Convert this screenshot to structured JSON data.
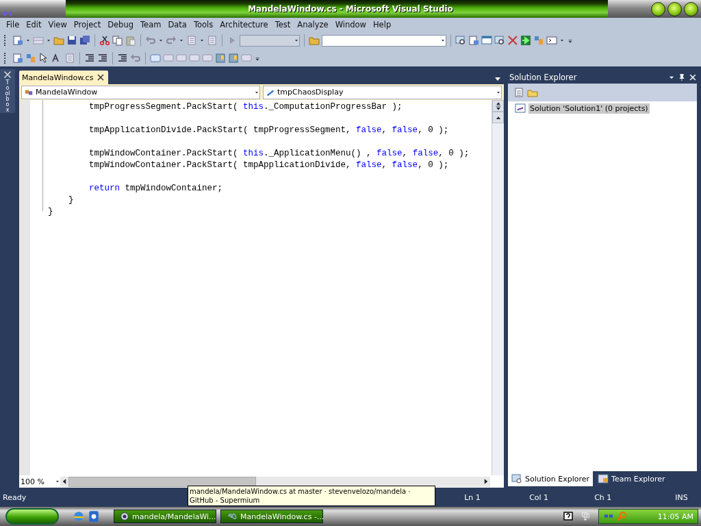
{
  "window": {
    "title": "MandelaWindow.cs - Microsoft Visual Studio"
  },
  "menu": [
    "File",
    "Edit",
    "View",
    "Project",
    "Debug",
    "Team",
    "Data",
    "Tools",
    "Architecture",
    "Test",
    "Analyze",
    "Window",
    "Help"
  ],
  "toolbox": {
    "label": "Toolbox"
  },
  "editor": {
    "tabs": [
      {
        "label": "MandelaWindow.cs",
        "selected": true
      }
    ],
    "type_dropdown": "MandelaWindow",
    "member_dropdown": "tmpChaosDisplay",
    "lines": [
      {
        "kind": "code",
        "tokens": [
          {
            "kind": "plain",
            "text": "        tmpProgressSegment.PackStart( "
          },
          {
            "kind": "keyword",
            "text": "this"
          },
          {
            "kind": "plain",
            "text": "._ComputationProgressBar );"
          }
        ]
      },
      {
        "kind": "blank"
      },
      {
        "kind": "code",
        "tokens": [
          {
            "kind": "plain",
            "text": "        tmpApplicationDivide.PackStart( tmpProgressSegment, "
          },
          {
            "kind": "keyword",
            "text": "false"
          },
          {
            "kind": "plain",
            "text": ", "
          },
          {
            "kind": "keyword",
            "text": "false"
          },
          {
            "kind": "plain",
            "text": ", 0 );"
          }
        ]
      },
      {
        "kind": "blank"
      },
      {
        "kind": "code",
        "tokens": [
          {
            "kind": "plain",
            "text": "        tmpWindowContainer.PackStart( "
          },
          {
            "kind": "keyword",
            "text": "this"
          },
          {
            "kind": "plain",
            "text": "._ApplicationMenu() , "
          },
          {
            "kind": "keyword",
            "text": "false"
          },
          {
            "kind": "plain",
            "text": ", "
          },
          {
            "kind": "keyword",
            "text": "false"
          },
          {
            "kind": "plain",
            "text": ", 0 );"
          }
        ]
      },
      {
        "kind": "code",
        "tokens": [
          {
            "kind": "plain",
            "text": "        tmpWindowContainer.PackStart( tmpApplicationDivide, "
          },
          {
            "kind": "keyword",
            "text": "false"
          },
          {
            "kind": "plain",
            "text": ", "
          },
          {
            "kind": "keyword",
            "text": "false"
          },
          {
            "kind": "plain",
            "text": ", 0 );"
          }
        ]
      },
      {
        "kind": "blank"
      },
      {
        "kind": "code",
        "tokens": [
          {
            "kind": "keyword",
            "text": "        return"
          },
          {
            "kind": "plain",
            "text": " tmpWindowContainer;"
          }
        ]
      },
      {
        "kind": "code",
        "tokens": [
          {
            "kind": "plain",
            "text": "    }"
          }
        ]
      },
      {
        "kind": "code",
        "tokens": [
          {
            "kind": "plain",
            "text": "}"
          }
        ]
      }
    ],
    "zoom": "100 %"
  },
  "solution_explorer": {
    "title": "Solution Explorer",
    "tree": [
      {
        "label": "Solution 'Solution1' (0 projects)",
        "selected": true
      }
    ],
    "tabs": [
      {
        "label": "Solution Explorer",
        "selected": true
      },
      {
        "label": "Team Explorer",
        "selected": false
      }
    ]
  },
  "status_bar": {
    "message": "Ready",
    "line": "Ln 1",
    "column": "Col 1",
    "char": "Ch 1",
    "mode": "INS"
  },
  "tooltip": {
    "text": "mandela/MandelaWindow.cs at master · stevenvelozo/mandela · GitHub - Supermium"
  },
  "taskbar": {
    "tasks": [
      {
        "label": "mandela/MandelaWi...",
        "kind": "browser"
      },
      {
        "label": "MandelaWindow.cs -...",
        "kind": "studio"
      }
    ],
    "clock": "11:05 AM"
  }
}
